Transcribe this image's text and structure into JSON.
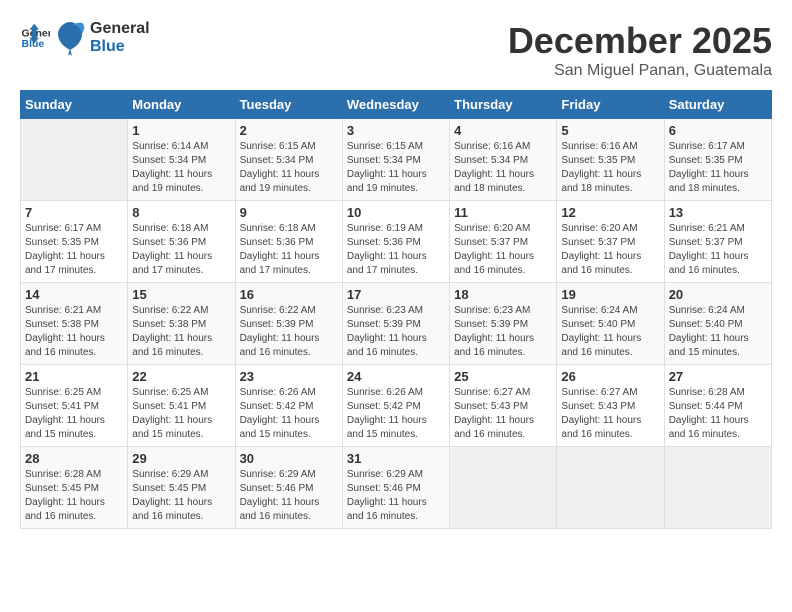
{
  "logo": {
    "line1": "General",
    "line2": "Blue"
  },
  "title": "December 2025",
  "location": "San Miguel Panan, Guatemala",
  "header_days": [
    "Sunday",
    "Monday",
    "Tuesday",
    "Wednesday",
    "Thursday",
    "Friday",
    "Saturday"
  ],
  "weeks": [
    [
      {
        "day": "",
        "info": ""
      },
      {
        "day": "1",
        "info": "Sunrise: 6:14 AM\nSunset: 5:34 PM\nDaylight: 11 hours\nand 19 minutes."
      },
      {
        "day": "2",
        "info": "Sunrise: 6:15 AM\nSunset: 5:34 PM\nDaylight: 11 hours\nand 19 minutes."
      },
      {
        "day": "3",
        "info": "Sunrise: 6:15 AM\nSunset: 5:34 PM\nDaylight: 11 hours\nand 19 minutes."
      },
      {
        "day": "4",
        "info": "Sunrise: 6:16 AM\nSunset: 5:34 PM\nDaylight: 11 hours\nand 18 minutes."
      },
      {
        "day": "5",
        "info": "Sunrise: 6:16 AM\nSunset: 5:35 PM\nDaylight: 11 hours\nand 18 minutes."
      },
      {
        "day": "6",
        "info": "Sunrise: 6:17 AM\nSunset: 5:35 PM\nDaylight: 11 hours\nand 18 minutes."
      }
    ],
    [
      {
        "day": "7",
        "info": "Sunrise: 6:17 AM\nSunset: 5:35 PM\nDaylight: 11 hours\nand 17 minutes."
      },
      {
        "day": "8",
        "info": "Sunrise: 6:18 AM\nSunset: 5:36 PM\nDaylight: 11 hours\nand 17 minutes."
      },
      {
        "day": "9",
        "info": "Sunrise: 6:18 AM\nSunset: 5:36 PM\nDaylight: 11 hours\nand 17 minutes."
      },
      {
        "day": "10",
        "info": "Sunrise: 6:19 AM\nSunset: 5:36 PM\nDaylight: 11 hours\nand 17 minutes."
      },
      {
        "day": "11",
        "info": "Sunrise: 6:20 AM\nSunset: 5:37 PM\nDaylight: 11 hours\nand 16 minutes."
      },
      {
        "day": "12",
        "info": "Sunrise: 6:20 AM\nSunset: 5:37 PM\nDaylight: 11 hours\nand 16 minutes."
      },
      {
        "day": "13",
        "info": "Sunrise: 6:21 AM\nSunset: 5:37 PM\nDaylight: 11 hours\nand 16 minutes."
      }
    ],
    [
      {
        "day": "14",
        "info": "Sunrise: 6:21 AM\nSunset: 5:38 PM\nDaylight: 11 hours\nand 16 minutes."
      },
      {
        "day": "15",
        "info": "Sunrise: 6:22 AM\nSunset: 5:38 PM\nDaylight: 11 hours\nand 16 minutes."
      },
      {
        "day": "16",
        "info": "Sunrise: 6:22 AM\nSunset: 5:39 PM\nDaylight: 11 hours\nand 16 minutes."
      },
      {
        "day": "17",
        "info": "Sunrise: 6:23 AM\nSunset: 5:39 PM\nDaylight: 11 hours\nand 16 minutes."
      },
      {
        "day": "18",
        "info": "Sunrise: 6:23 AM\nSunset: 5:39 PM\nDaylight: 11 hours\nand 16 minutes."
      },
      {
        "day": "19",
        "info": "Sunrise: 6:24 AM\nSunset: 5:40 PM\nDaylight: 11 hours\nand 16 minutes."
      },
      {
        "day": "20",
        "info": "Sunrise: 6:24 AM\nSunset: 5:40 PM\nDaylight: 11 hours\nand 15 minutes."
      }
    ],
    [
      {
        "day": "21",
        "info": "Sunrise: 6:25 AM\nSunset: 5:41 PM\nDaylight: 11 hours\nand 15 minutes."
      },
      {
        "day": "22",
        "info": "Sunrise: 6:25 AM\nSunset: 5:41 PM\nDaylight: 11 hours\nand 15 minutes."
      },
      {
        "day": "23",
        "info": "Sunrise: 6:26 AM\nSunset: 5:42 PM\nDaylight: 11 hours\nand 15 minutes."
      },
      {
        "day": "24",
        "info": "Sunrise: 6:26 AM\nSunset: 5:42 PM\nDaylight: 11 hours\nand 15 minutes."
      },
      {
        "day": "25",
        "info": "Sunrise: 6:27 AM\nSunset: 5:43 PM\nDaylight: 11 hours\nand 16 minutes."
      },
      {
        "day": "26",
        "info": "Sunrise: 6:27 AM\nSunset: 5:43 PM\nDaylight: 11 hours\nand 16 minutes."
      },
      {
        "day": "27",
        "info": "Sunrise: 6:28 AM\nSunset: 5:44 PM\nDaylight: 11 hours\nand 16 minutes."
      }
    ],
    [
      {
        "day": "28",
        "info": "Sunrise: 6:28 AM\nSunset: 5:45 PM\nDaylight: 11 hours\nand 16 minutes."
      },
      {
        "day": "29",
        "info": "Sunrise: 6:29 AM\nSunset: 5:45 PM\nDaylight: 11 hours\nand 16 minutes."
      },
      {
        "day": "30",
        "info": "Sunrise: 6:29 AM\nSunset: 5:46 PM\nDaylight: 11 hours\nand 16 minutes."
      },
      {
        "day": "31",
        "info": "Sunrise: 6:29 AM\nSunset: 5:46 PM\nDaylight: 11 hours\nand 16 minutes."
      },
      {
        "day": "",
        "info": ""
      },
      {
        "day": "",
        "info": ""
      },
      {
        "day": "",
        "info": ""
      }
    ]
  ]
}
